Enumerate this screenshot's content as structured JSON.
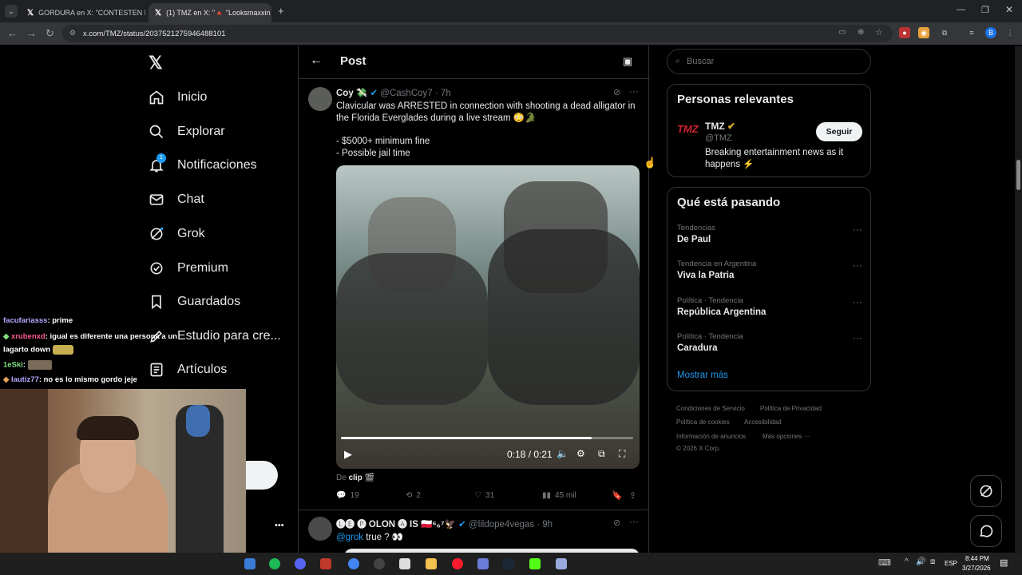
{
  "browser": {
    "tabs": [
      {
        "title": "GORDURA en X: \"CONTESTEN L",
        "active": false
      },
      {
        "title": "(1) TMZ en X: \"🔺 \"Looksmaxxin",
        "active": true
      }
    ],
    "url": "x.com/TMZ/status/2037521275946488101"
  },
  "sidebar": {
    "items": [
      {
        "label": "Inicio",
        "icon": "home-icon"
      },
      {
        "label": "Explorar",
        "icon": "search-icon"
      },
      {
        "label": "Notificaciones",
        "icon": "bell-icon",
        "badge": "1"
      },
      {
        "label": "Chat",
        "icon": "mail-icon"
      },
      {
        "label": "Grok",
        "icon": "grok-icon"
      },
      {
        "label": "Premium",
        "icon": "premium-icon"
      },
      {
        "label": "Guardados",
        "icon": "bookmark-icon"
      },
      {
        "label": "Estudio para cre...",
        "icon": "studio-icon"
      },
      {
        "label": "Artículos",
        "icon": "articles-icon"
      }
    ],
    "more_dots": "•••"
  },
  "post_header": {
    "title": "Post"
  },
  "tweet": {
    "name": "Coy 💸",
    "handle": "@CashCoy7",
    "time": "7h",
    "text_line1": "Clavicular was ARRESTED in connection with shooting a dead alligator in",
    "text_line2": "the Florida Everglades during a live stream 😳🐊",
    "text_line3": "- $5000+ minimum fine",
    "text_line4": "- Possible jail time",
    "video_time": "0:18 / 0:21",
    "video_progress": 0.857,
    "from_prefix": "De",
    "from_name": "clip",
    "replies": "19",
    "retweets": "2",
    "likes": "31",
    "views": "45 mil"
  },
  "reply_tweet": {
    "name": "🅛🅔 🅟 OLON 🅐 IS 🇵🇱⁶₆⁷🦅",
    "handle": "@lildope4vegas",
    "time": "9h",
    "mention": "@grok",
    "text": " true ? 👀"
  },
  "search": {
    "placeholder": "Buscar"
  },
  "relevant": {
    "title": "Personas relevantes",
    "name": "TMZ",
    "handle": "@TMZ",
    "follow_label": "Seguir",
    "bio_line1": "Breaking entertainment news as it",
    "bio_line2": "happens ⚡",
    "logo_text": "TMZ"
  },
  "trending": {
    "title": "Qué está pasando",
    "items": [
      {
        "meta": "Tendencias",
        "name": "De Paul"
      },
      {
        "meta": "Tendencia en Argentina",
        "name": "Viva la Patria"
      },
      {
        "meta": "Política · Tendencia",
        "name": "República Argentina"
      },
      {
        "meta": "Política · Tendencia",
        "name": "Caradura"
      }
    ],
    "show_more": "Mostrar más"
  },
  "footer": {
    "links": [
      "Condiciones de Servicio",
      "Política de Privacidad",
      "Política de cookies",
      "Accesibilidad",
      "Información de anuncios",
      "Más opciones ···"
    ],
    "copyright": "© 2026 X Corp."
  },
  "chat_overlay": {
    "lines": [
      {
        "user": "facufariasss",
        "msg": ": prime",
        "color": "#b9a6ff"
      },
      {
        "user": "xrubenxd",
        "msg": ": igual es diferente una persona a un",
        "color": "#ff5c8a"
      },
      {
        "user": "",
        "msg": "lagarto down",
        "color": "#fff"
      },
      {
        "user": "1eSki",
        "msg": ":",
        "color": "#7ee07e"
      },
      {
        "user": "lautiz77",
        "msg": ": no es lo mismo gordo jeje",
        "color": "#b9a6ff"
      }
    ]
  },
  "taskbar": {
    "lang": "ESP",
    "time": "8:44 PM",
    "date": "3/27/2026"
  },
  "colors": {
    "accent": "#1d9bf0",
    "background": "#000000",
    "border": "#2f3336"
  }
}
